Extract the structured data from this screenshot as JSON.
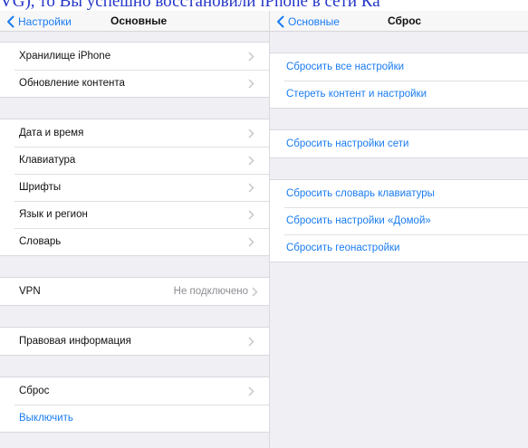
{
  "cut_text": "VG), то Вы успешно восстановили iPhone в сети Ка",
  "left_panel": {
    "back_label": "Настройки",
    "title": "Основные",
    "groups": [
      [
        {
          "label": "Хранилище iPhone"
        },
        {
          "label": "Обновление контента"
        }
      ],
      [
        {
          "label": "Дата и время"
        },
        {
          "label": "Клавиатура"
        },
        {
          "label": "Шрифты"
        },
        {
          "label": "Язык и регион"
        },
        {
          "label": "Словарь"
        }
      ],
      [
        {
          "label": "VPN",
          "value": "Не подключено"
        }
      ],
      [
        {
          "label": "Правовая информация"
        }
      ],
      [
        {
          "label": "Сброс"
        },
        {
          "label": "Выключить"
        }
      ]
    ]
  },
  "right_panel": {
    "back_label": "Основные",
    "title": "Сброс",
    "groups": [
      [
        {
          "label": "Сбросить все настройки"
        },
        {
          "label": "Стереть контент и настройки"
        }
      ],
      [
        {
          "label": "Сбросить настройки сети"
        }
      ],
      [
        {
          "label": "Сбросить словарь клавиатуры"
        },
        {
          "label": "Сбросить настройки «Домой»"
        },
        {
          "label": "Сбросить геонастройки"
        }
      ]
    ]
  },
  "colors": {
    "accent": "#1a7cf2",
    "group_background": "#efeff4",
    "secondary_text": "#8e8e93"
  },
  "icons": {
    "back": "chevron-left-icon",
    "disclosure": "chevron-right-icon"
  }
}
